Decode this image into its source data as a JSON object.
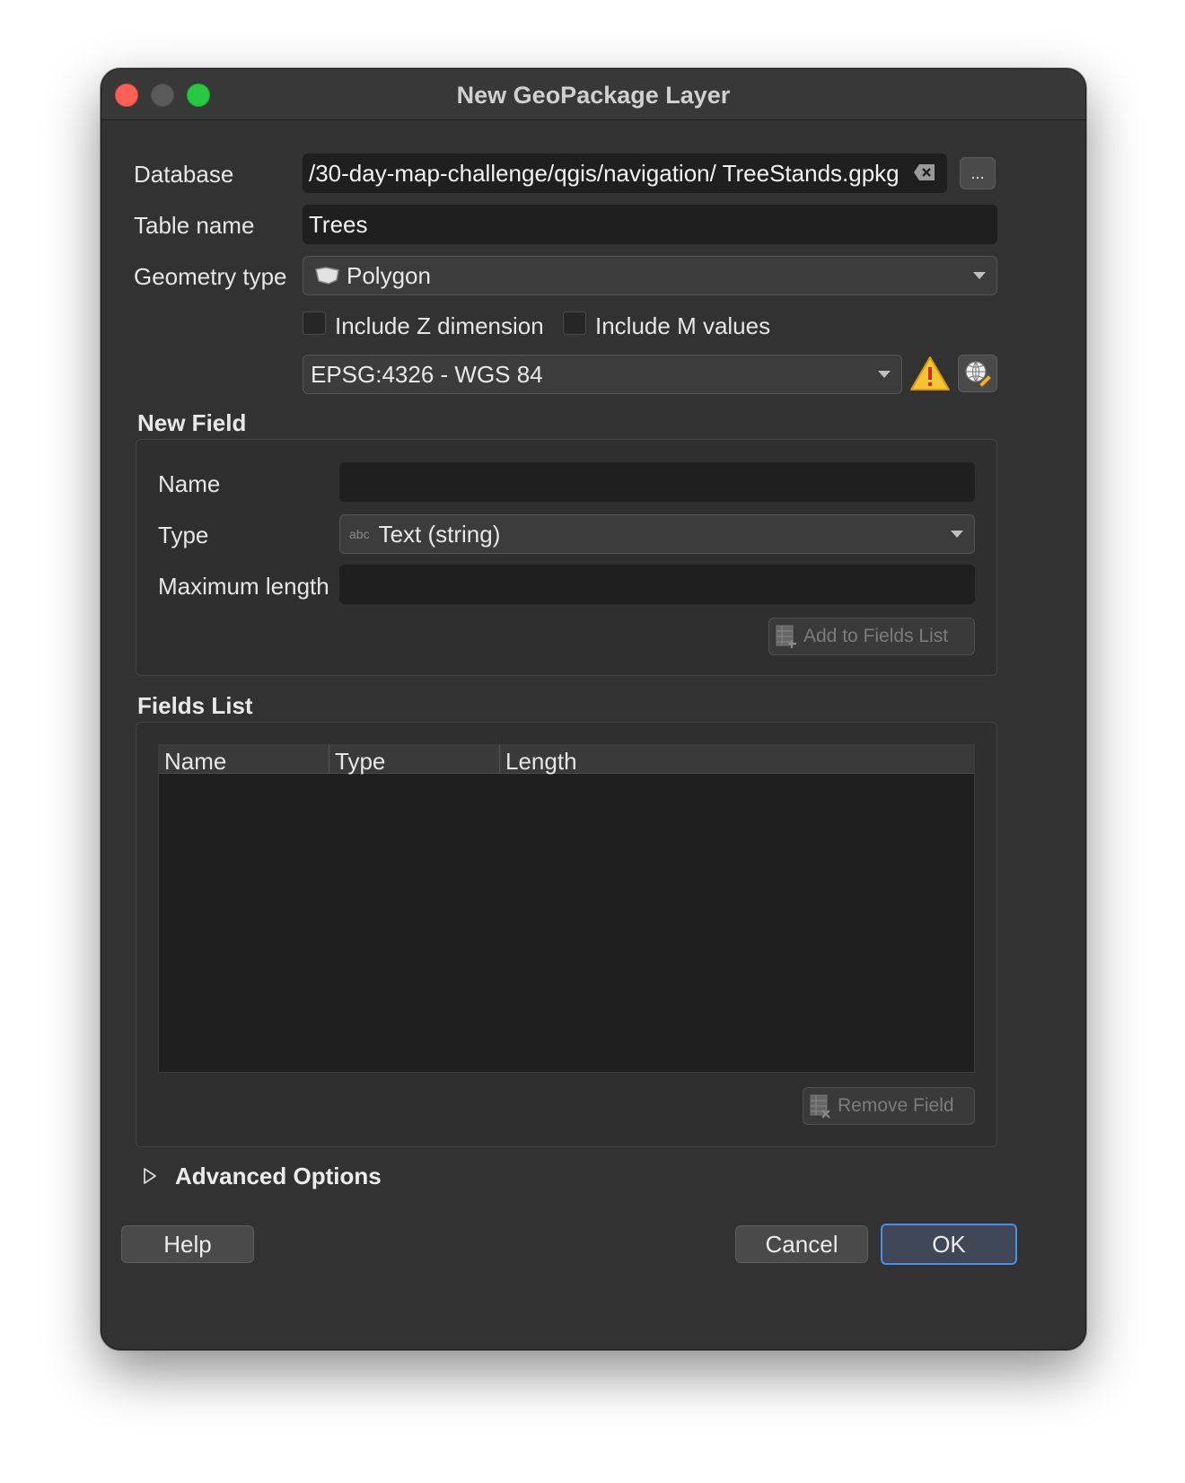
{
  "window": {
    "title": "New GeoPackage Layer"
  },
  "form": {
    "database_label": "Database",
    "database_value": "/30-day-map-challenge/qgis/navigation/ TreeStands.gpkg",
    "browse_label": "...",
    "table_name_label": "Table name",
    "table_name_value": "Trees",
    "geometry_type_label": "Geometry type",
    "geometry_type_value": "Polygon",
    "include_z_label": "Include Z dimension",
    "include_m_label": "Include M values",
    "crs_value": "EPSG:4326 - WGS 84"
  },
  "new_field": {
    "title": "New Field",
    "name_label": "Name",
    "name_value": "",
    "type_label": "Type",
    "type_icon_text": "abc",
    "type_value": "Text (string)",
    "max_length_label": "Maximum length",
    "max_length_value": "",
    "add_button": "Add to Fields List"
  },
  "fields_list": {
    "title": "Fields List",
    "columns": [
      "Name",
      "Type",
      "Length"
    ],
    "rows": [],
    "remove_button": "Remove Field"
  },
  "advanced": {
    "label": "Advanced Options"
  },
  "footer": {
    "help": "Help",
    "cancel": "Cancel",
    "ok": "OK"
  }
}
